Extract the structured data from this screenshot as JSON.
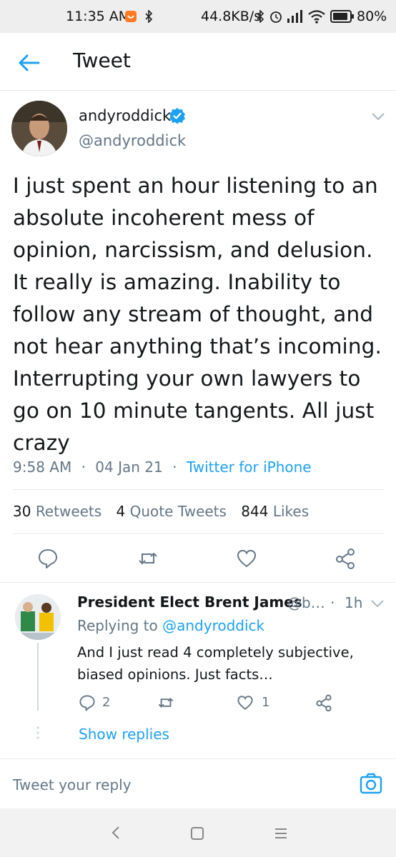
{
  "status_bar": {
    "time": "11:35 AM",
    "network_speed": "44.8KB/s",
    "battery": "80%"
  },
  "header": {
    "title": "Tweet"
  },
  "tweet": {
    "name": "andyroddick",
    "handle": "@andyroddick",
    "text": "I just spent an hour listening to an absolute incoherent mess of opinion, narcissism, and delusion. It really is amazing. Inability to follow any stream of thought, and not hear anything that’s incoming. Interrupting your own lawyers to go on 10 minute tangents. All just crazy",
    "time": "9:58 AM",
    "date": "04 Jan 21",
    "source": "Twitter for iPhone",
    "separator": "·",
    "stats": {
      "retweets_count": "30",
      "retweets_label": "Retweets",
      "quote_count": "4",
      "quote_label": "Quote Tweets",
      "likes_count": "844",
      "likes_label": "Likes"
    }
  },
  "reply": {
    "name": "President Elect Brent James",
    "handle": "@b…",
    "separator": "·",
    "time": "1h",
    "replying_prefix": "Replying to",
    "replying_to": "@andyroddick",
    "text": "And I just read 4 completely subjective, biased opinions. Just facts…",
    "reply_count": "2",
    "like_count": "1",
    "show_replies": "Show replies"
  },
  "composer": {
    "placeholder": "Tweet your reply"
  },
  "colors": {
    "accent": "#1da1f2",
    "secondary_text": "#657786",
    "primary_text": "#14171a"
  }
}
